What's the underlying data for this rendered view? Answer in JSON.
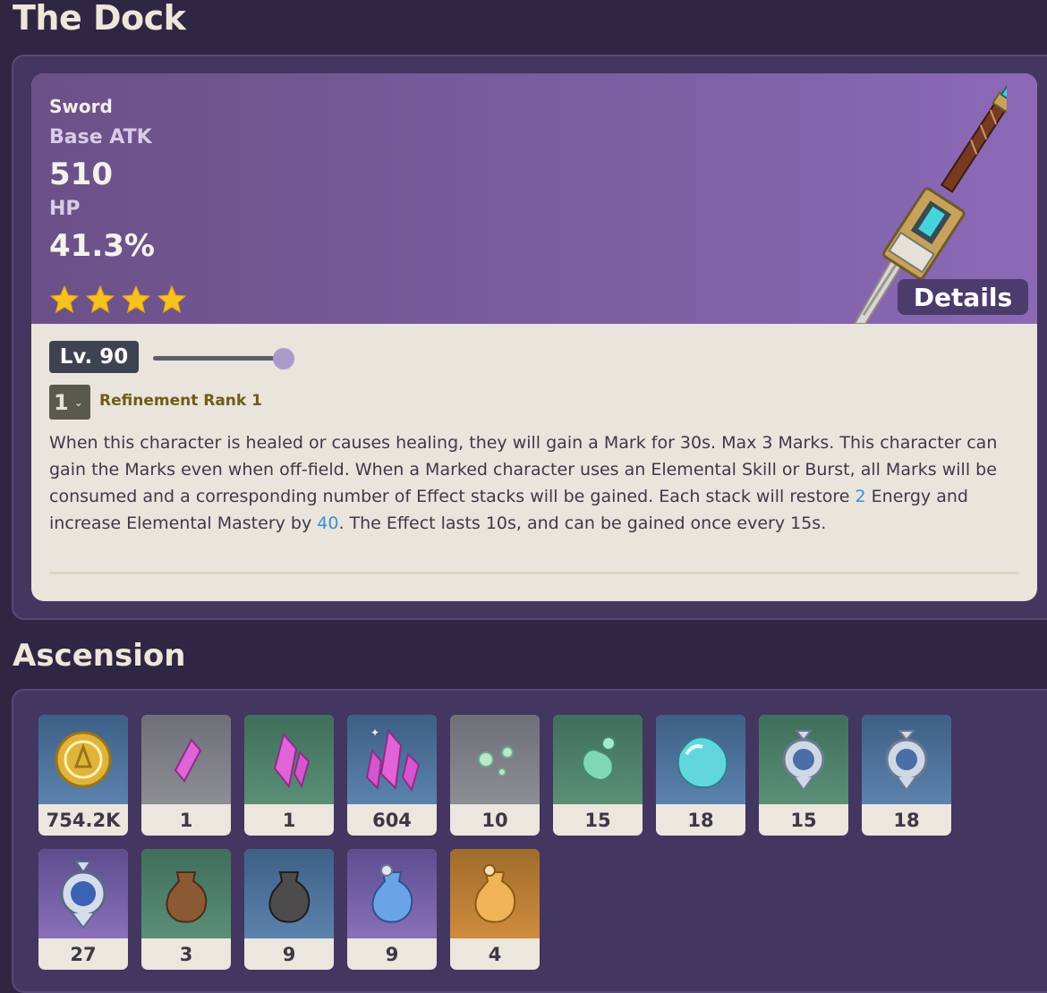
{
  "page": {
    "title": "The Dock"
  },
  "weapon": {
    "type": "Sword",
    "stat1_label": "Base ATK",
    "stat1_value": "510",
    "stat2_label": "HP",
    "stat2_value": "41.3%",
    "rarity_stars": 4,
    "details_label": "Details",
    "level_label": "Lv. 90",
    "level_progress": 1.0,
    "refinement_selected": "1",
    "refinement_label": "Refinement Rank 1",
    "passive": {
      "part1": "When this character is healed or causes healing, they will gain a Mark for 30s. Max 3 Marks. This character can gain the Marks even when off-field. When a Marked character uses an Elemental Skill or Burst, all Marks will be consumed and a corresponding number of Effect stacks will be gained. Each stack will restore ",
      "value1": "2",
      "part2": " Energy and increase Elemental Mastery by ",
      "value2": "40",
      "part3": ". The Effect lasts 10s, and can be gained once every 15s."
    }
  },
  "ascension": {
    "title": "Ascension",
    "items": [
      {
        "icon": "mora-coin-icon",
        "count": "754.2K",
        "rarity": "r3"
      },
      {
        "icon": "pink-crystal-sliver-icon",
        "count": "1",
        "rarity": "r1"
      },
      {
        "icon": "pink-crystal-fragment-icon",
        "count": "1",
        "rarity": "r2"
      },
      {
        "icon": "pink-crystal-chunk-icon",
        "count": "604",
        "rarity": "r3"
      },
      {
        "icon": "water-droplets-small-icon",
        "count": "10",
        "rarity": "r1"
      },
      {
        "icon": "water-droplets-medium-icon",
        "count": "15",
        "rarity": "r2"
      },
      {
        "icon": "water-droplet-large-icon",
        "count": "18",
        "rarity": "r3"
      },
      {
        "icon": "silver-pendant-icon",
        "count": "15",
        "rarity": "r2"
      },
      {
        "icon": "silver-pendant-icon",
        "count": "18",
        "rarity": "r3"
      },
      {
        "icon": "ornate-pendant-icon",
        "count": "27",
        "rarity": "r4"
      },
      {
        "icon": "brown-flask-icon",
        "count": "3",
        "rarity": "r2"
      },
      {
        "icon": "dark-flask-icon",
        "count": "9",
        "rarity": "r3"
      },
      {
        "icon": "blue-flask-icon",
        "count": "9",
        "rarity": "r4"
      },
      {
        "icon": "gold-flask-icon",
        "count": "4",
        "rarity": "r5"
      }
    ]
  }
}
